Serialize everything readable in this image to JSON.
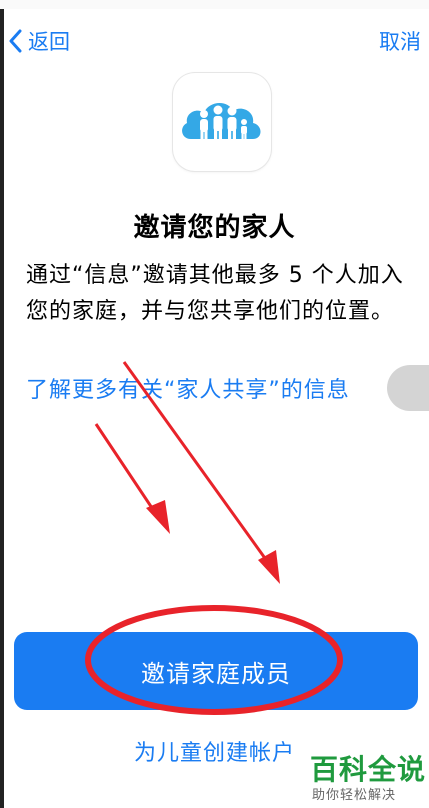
{
  "nav": {
    "back_label": "返回",
    "cancel_label": "取消"
  },
  "header": {
    "title": "邀请您的家人"
  },
  "body": {
    "description": "通过“信息”邀请其他最多 5 个人加入您的家庭，并与您共享他们的位置。",
    "learn_more": "了解更多有关“家人共享”的信息"
  },
  "actions": {
    "invite_button": "邀请家庭成员",
    "child_account": "为儿童创建帐户"
  },
  "watermark": {
    "brand": "百科全说",
    "tagline": "助你轻松解决"
  },
  "colors": {
    "accent": "#1a7cf2",
    "annotation": "#e8232a",
    "watermark": "#1f9a3e"
  },
  "icons": {
    "back": "chevron-left-icon",
    "app": "family-sharing-icon"
  }
}
